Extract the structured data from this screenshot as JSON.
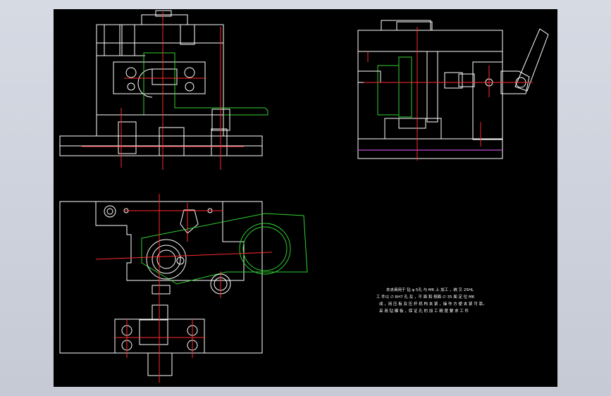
{
  "viewer": {
    "background_color": "#cfd3dd",
    "canvas_color": "#000000"
  },
  "colors": {
    "outline": "#ffffff",
    "centerline": "#ff2a2a",
    "phantom_part": "#2fd12f",
    "base_line": "#c04ad8"
  },
  "drawing": {
    "views": [
      "front-view",
      "side-view",
      "top-view"
    ],
    "technical_note": {
      "lines": [
        "本夹具用于 钻 φ 5孔 与 M6 上 加工 ，统 又 25HL",
        "工 件以 ∅ 6H7 孔 及 ，平 面 和 侧面 ∅ 35 面 定 位 M6",
        "成 ，用 压 板 及 压 杆 机 构 夹 紧 ，操 作 方 便 夹 紧 可 靠。",
        "采 用 钻 模 板 ，保 证 孔 的 加 工 精 度 要 求 工 件"
      ]
    }
  }
}
